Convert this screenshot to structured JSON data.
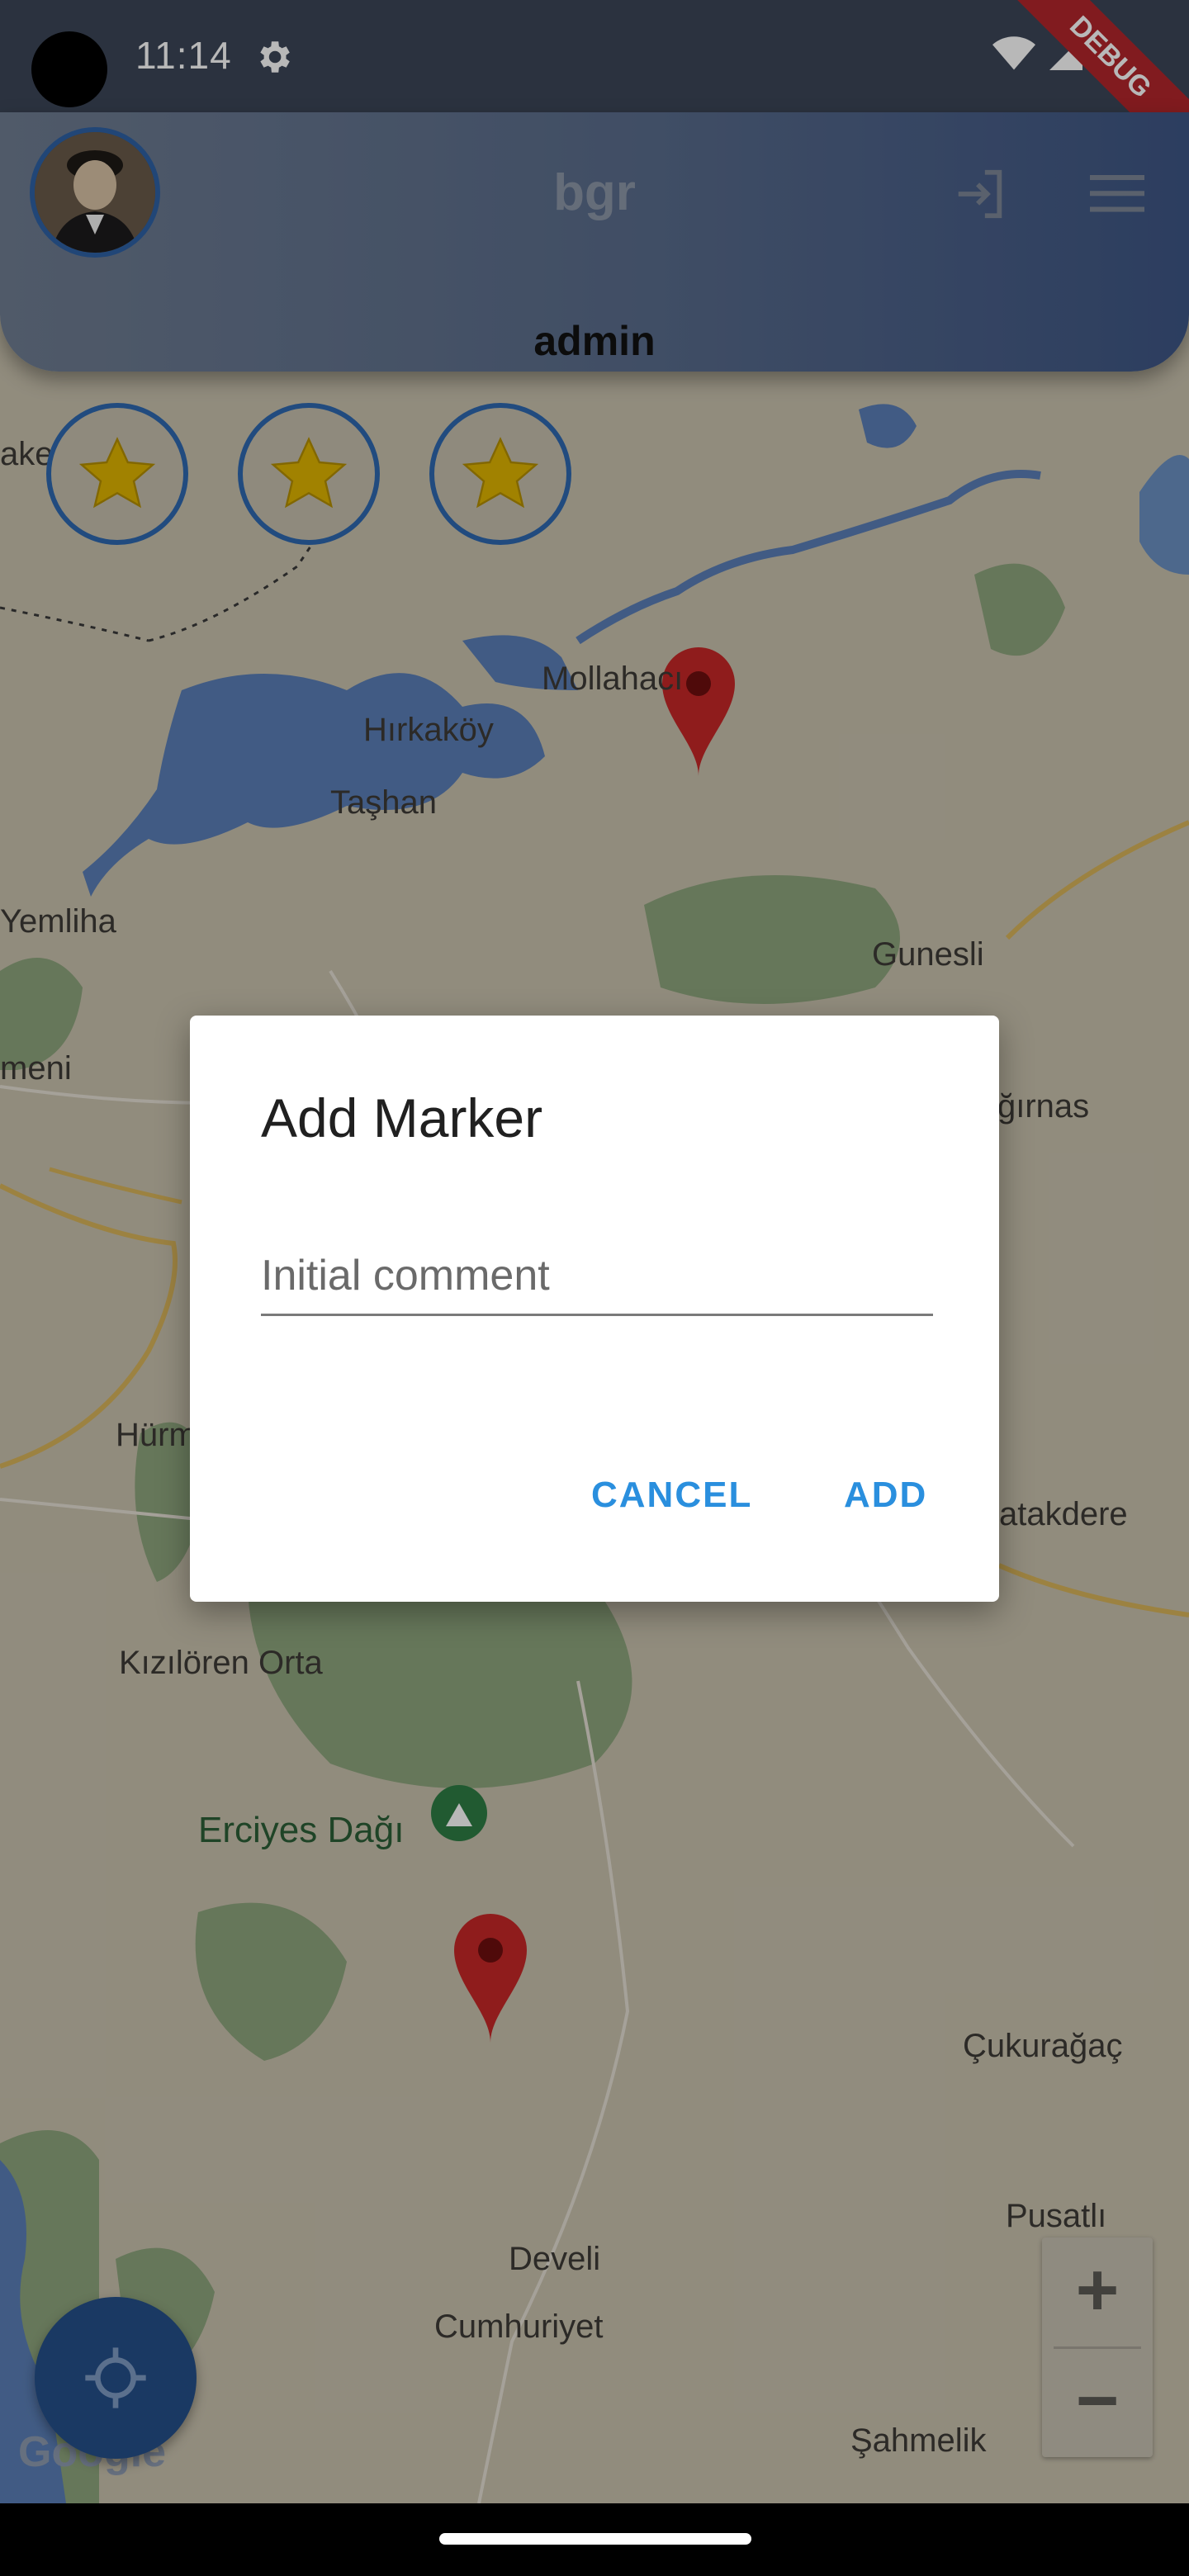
{
  "status_bar": {
    "time": "11:14",
    "icons": [
      "settings-gear-icon",
      "wifi-icon",
      "signal-icon",
      "battery-icon"
    ],
    "debug_banner": "DEBUG"
  },
  "app_bar": {
    "title": "bgr",
    "username": "admin",
    "icons": [
      "login-icon",
      "menu-icon"
    ]
  },
  "star_badges": [
    {
      "icon": "star-icon"
    },
    {
      "icon": "star-icon"
    },
    {
      "icon": "star-icon"
    }
  ],
  "map": {
    "labels": {
      "ake": "ake",
      "mollahaci": "Mollahacı",
      "hirkakoy": "Hırkaköy",
      "tashan": "Taşhan",
      "yemliha": "Yemliha",
      "gunesli": "Gunesli",
      "meni": "meni",
      "girnas": "ğırnas",
      "hurm": "Hürm",
      "atakdere": "atakdere",
      "kiziloren": "Kızılören Orta",
      "erciyes": "Erciyes Dağı",
      "cukuragac": "Çukurağaç",
      "pusatli": "Pusatlı",
      "develi": "Develi",
      "cumhuriyet": "Cumhuriyet",
      "sahmelik": "Şahmelik"
    },
    "attribution": "Google",
    "zoom_in": "+",
    "zoom_out": "−"
  },
  "dialog": {
    "title": "Add Marker",
    "input_placeholder": "Initial comment",
    "input_value": "",
    "cancel_label": "CANCEL",
    "add_label": "ADD"
  },
  "colors": {
    "accent": "#2a8fde",
    "marker": "#c62828",
    "star": "#e0b400",
    "app_bar_end": "#3e5685"
  }
}
